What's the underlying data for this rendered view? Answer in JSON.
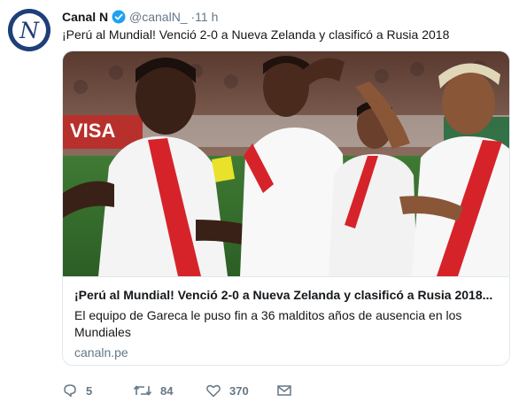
{
  "tweet": {
    "display_name": "Canal N",
    "handle": "@canalN_",
    "separator": "·",
    "time": "11 h",
    "text": "¡Perú al Mundial! Venció 2-0 a Nueva Zelanda y clasificó a Rusia 2018",
    "avatar_letter": "N"
  },
  "card": {
    "title": "¡Perú al Mundial! Venció 2-0 a Nueva Zelanda y clasificó a Rusia 2018...",
    "description": "El equipo de Gareca le puso fin a 36 malditos años de ausencia en los Mundiales",
    "domain": "canaln.pe",
    "image_text": "VISA"
  },
  "actions": {
    "replies": "5",
    "retweets": "84",
    "likes": "370"
  },
  "colors": {
    "verified": "#1da1f2",
    "avatar_bg": "#1f3f7a",
    "secondary_text": "#657786",
    "border": "#e1e8ed",
    "jersey_red": "#d6232a"
  }
}
